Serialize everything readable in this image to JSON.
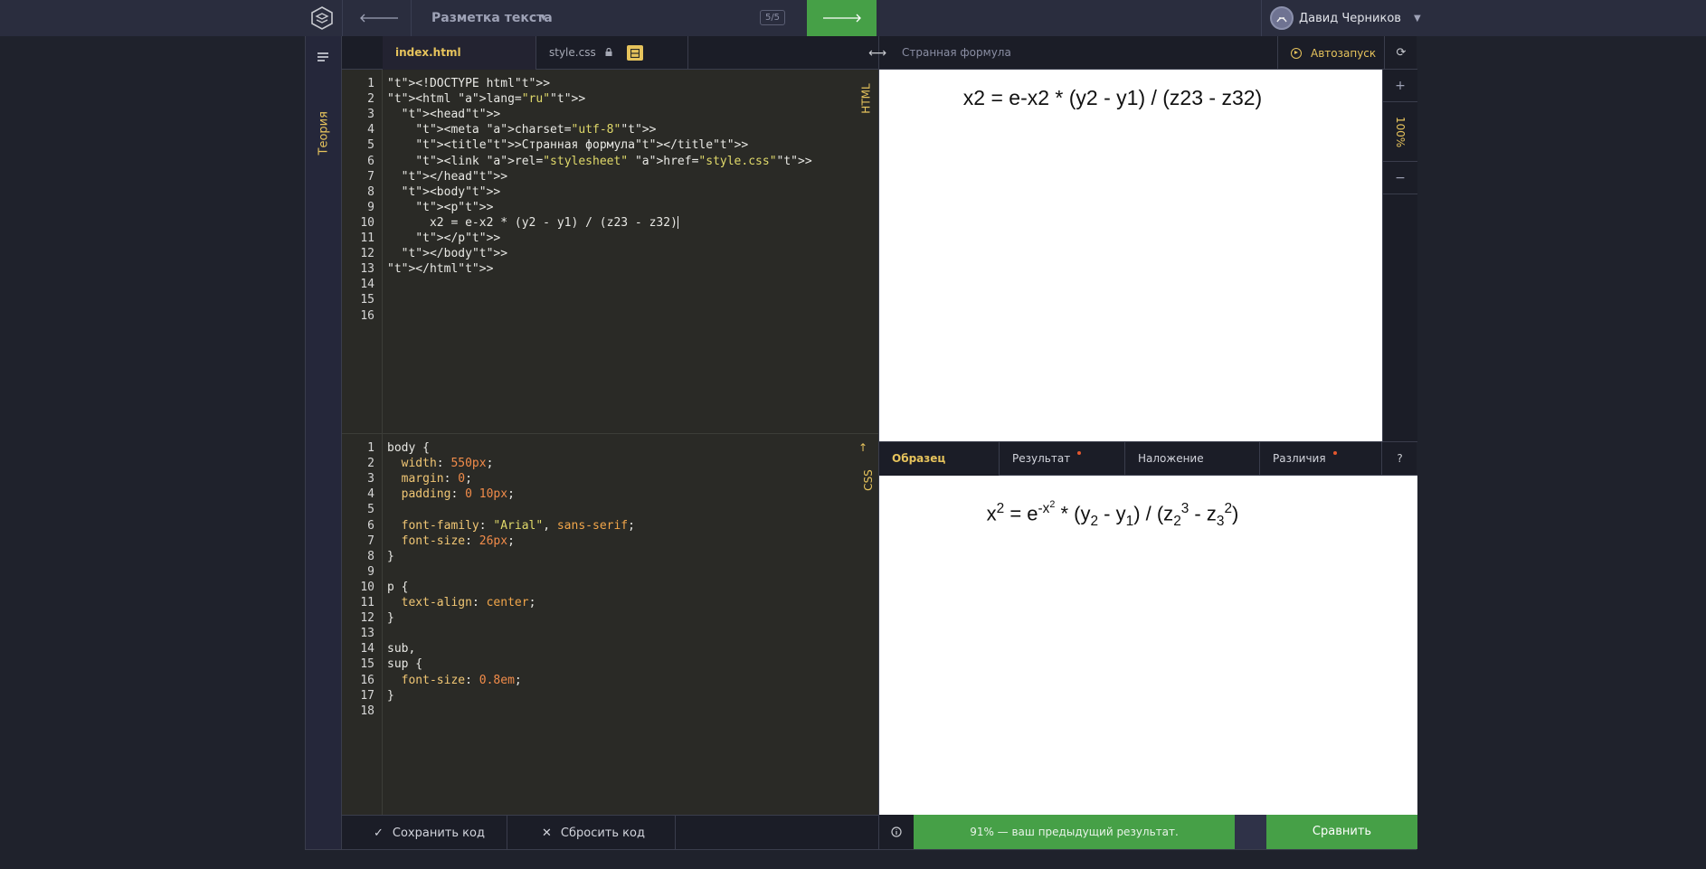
{
  "topbar": {
    "course_title": "Разметка текста",
    "progress": "5/5",
    "user_name": "Давид Черников"
  },
  "sidebar": {
    "theory_label": "Теория"
  },
  "editor": {
    "tabs": [
      {
        "label": "index.html",
        "active": true
      },
      {
        "label": "style.css",
        "locked": true
      }
    ],
    "html_label": "HTML",
    "css_label": "CSS",
    "html_line_count": 16,
    "css_line_count": 18,
    "html_lines": [
      "<!DOCTYPE html>",
      "<html lang=\"ru\">",
      "  <head>",
      "    <meta charset=\"utf-8\">",
      "    <title>Странная формула</title>",
      "    <link rel=\"stylesheet\" href=\"style.css\">",
      "  </head>",
      "  <body>",
      "    <p>",
      "      x2 = e-x2 * (y2 - y1) / (z23 - z32)",
      "    </p>",
      "  </body>",
      "</html>"
    ],
    "css_lines": [
      "body {",
      "  width: 550px;",
      "  margin: 0;",
      "  padding: 0 10px;",
      "",
      "  font-family: \"Arial\", sans-serif;",
      "  font-size: 26px;",
      "}",
      "",
      "p {",
      "  text-align: center;",
      "}",
      "",
      "sub,",
      "sup {",
      "  font-size: 0.8em;",
      "}"
    ],
    "save_label": "Сохранить код",
    "reset_label": "Сбросить код"
  },
  "preview": {
    "page_title": "Странная формула",
    "autorun_label": "Автозапуск",
    "rendered_text": "x2 = e-x2 * (y2 - y1) / (z23 - z32)",
    "zoom": "100%",
    "zoom_in": "+",
    "zoom_out": "−"
  },
  "compare": {
    "tabs": [
      {
        "label": "Образец",
        "active": true
      },
      {
        "label": "Результат",
        "dot": true
      },
      {
        "label": "Наложение"
      },
      {
        "label": "Различия",
        "dot": true
      }
    ],
    "help": "?",
    "sample_formula": {
      "x": "x",
      "x_exp": "2",
      "eq": " = e",
      "e_exp": "-x",
      "e_exp_exp": "2",
      "mid": " * (y",
      "y_sub1": "2",
      "minus1": " - y",
      "y_sub2": "1",
      "div": ") / (z",
      "z_sub1": "2",
      "z_exp1": "3",
      "minus2": " - z",
      "z_sub2": "3",
      "z_exp2": "2",
      "close": ")"
    },
    "result_message": "91% — ваш предыдущий результат.",
    "compare_label": "Сравнить"
  },
  "colors": {
    "accent": "#e6c35c",
    "success": "#46a047",
    "background": "#1f222c"
  }
}
